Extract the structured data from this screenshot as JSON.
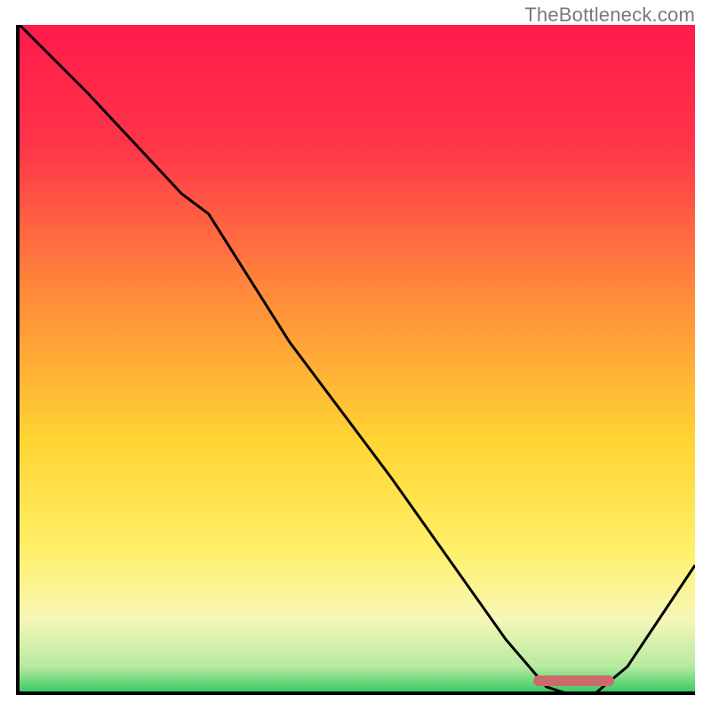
{
  "watermark": "TheBottleneck.com",
  "chart_data": {
    "type": "line",
    "title": "",
    "xlabel": "",
    "ylabel": "",
    "xlim": [
      0,
      100
    ],
    "ylim": [
      0,
      100
    ],
    "grid": false,
    "gradient_stops": [
      {
        "pos": 0,
        "color": "#ff1a4b"
      },
      {
        "pos": 18,
        "color": "#ff354a"
      },
      {
        "pos": 40,
        "color": "#ff8b3a"
      },
      {
        "pos": 62,
        "color": "#ffd633"
      },
      {
        "pos": 78,
        "color": "#fff06a"
      },
      {
        "pos": 88,
        "color": "#f7f7b8"
      },
      {
        "pos": 95,
        "color": "#b6eaa0"
      },
      {
        "pos": 100,
        "color": "#10c050"
      }
    ],
    "series": [
      {
        "name": "bottleneck-curve",
        "x": [
          0,
          10,
          24,
          28,
          40,
          55,
          72,
          78,
          84,
          90,
          100
        ],
        "y": [
          100,
          90,
          75,
          72,
          53,
          33,
          9,
          2,
          0,
          5,
          20
        ]
      }
    ],
    "optimal_marker": {
      "x_start": 76,
      "x_end": 88,
      "y": 0.8
    }
  }
}
